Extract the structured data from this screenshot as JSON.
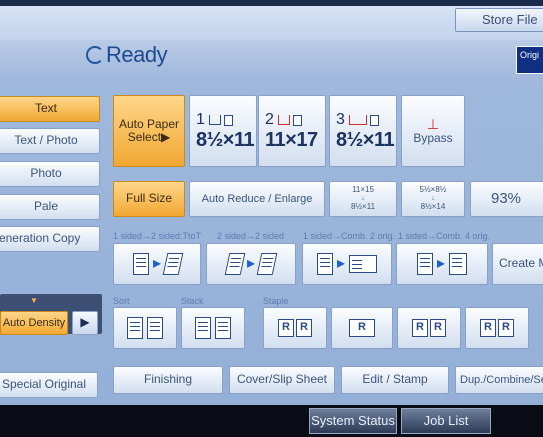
{
  "header": {
    "store_file": "Store File",
    "status": "Ready",
    "original_label": "Origi"
  },
  "modes": [
    {
      "label": "Text",
      "selected": true
    },
    {
      "label": "Text / Photo",
      "selected": false
    },
    {
      "label": "Photo",
      "selected": false
    },
    {
      "label": "Pale",
      "selected": false
    },
    {
      "label": "Generation Copy",
      "selected": false
    }
  ],
  "density": {
    "label": "Auto Density",
    "arrow": "▶"
  },
  "special_original": "Special Original",
  "paper": {
    "auto_select": "Auto Paper Select▶",
    "trays": [
      {
        "num": "1",
        "size": "8½×11"
      },
      {
        "num": "2",
        "size": "11×17"
      },
      {
        "num": "3",
        "size": "8½×11"
      }
    ],
    "bypass": "Bypass"
  },
  "ratio": {
    "full_size": "Full Size",
    "auto_reduce": "Auto Reduce / Enlarge",
    "preset1_top": "11×15",
    "preset1_bottom": "8½×11",
    "preset2_top": "5½×8½",
    "preset2_bottom": "8½×14",
    "percent": "93%"
  },
  "duplex": {
    "labels": [
      "1 sided→2 sided:TtoT",
      "2 sided→2 sided",
      "1 sided→Comb. 2 orig.",
      "1 sided→Comb. 4 orig."
    ],
    "create": "Create M"
  },
  "finishing_section": {
    "sort_label": "Sort",
    "stack_label": "Stack",
    "staple_label": "Staple"
  },
  "bottom_tabs": [
    "Finishing",
    "Cover/Slip Sheet",
    "Edit / Stamp",
    "Dup./Combine/Se"
  ],
  "system": {
    "system_status": "System Status",
    "job_list": "Job List"
  }
}
